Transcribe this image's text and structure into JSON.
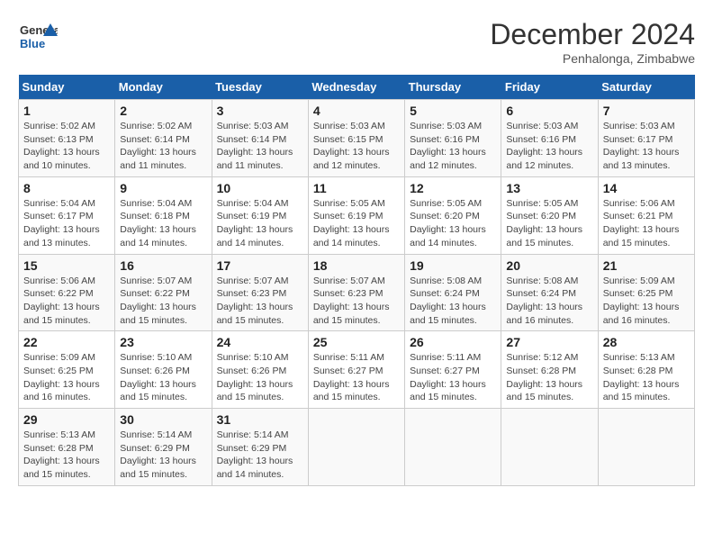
{
  "logo": {
    "general": "General",
    "blue": "Blue"
  },
  "header": {
    "month": "December 2024",
    "location": "Penhalonga, Zimbabwe"
  },
  "weekdays": [
    "Sunday",
    "Monday",
    "Tuesday",
    "Wednesday",
    "Thursday",
    "Friday",
    "Saturday"
  ],
  "weeks": [
    [
      {
        "day": "1",
        "info": "Sunrise: 5:02 AM\nSunset: 6:13 PM\nDaylight: 13 hours\nand 10 minutes."
      },
      {
        "day": "2",
        "info": "Sunrise: 5:02 AM\nSunset: 6:14 PM\nDaylight: 13 hours\nand 11 minutes."
      },
      {
        "day": "3",
        "info": "Sunrise: 5:03 AM\nSunset: 6:14 PM\nDaylight: 13 hours\nand 11 minutes."
      },
      {
        "day": "4",
        "info": "Sunrise: 5:03 AM\nSunset: 6:15 PM\nDaylight: 13 hours\nand 12 minutes."
      },
      {
        "day": "5",
        "info": "Sunrise: 5:03 AM\nSunset: 6:16 PM\nDaylight: 13 hours\nand 12 minutes."
      },
      {
        "day": "6",
        "info": "Sunrise: 5:03 AM\nSunset: 6:16 PM\nDaylight: 13 hours\nand 12 minutes."
      },
      {
        "day": "7",
        "info": "Sunrise: 5:03 AM\nSunset: 6:17 PM\nDaylight: 13 hours\nand 13 minutes."
      }
    ],
    [
      {
        "day": "8",
        "info": "Sunrise: 5:04 AM\nSunset: 6:17 PM\nDaylight: 13 hours\nand 13 minutes."
      },
      {
        "day": "9",
        "info": "Sunrise: 5:04 AM\nSunset: 6:18 PM\nDaylight: 13 hours\nand 14 minutes."
      },
      {
        "day": "10",
        "info": "Sunrise: 5:04 AM\nSunset: 6:19 PM\nDaylight: 13 hours\nand 14 minutes."
      },
      {
        "day": "11",
        "info": "Sunrise: 5:05 AM\nSunset: 6:19 PM\nDaylight: 13 hours\nand 14 minutes."
      },
      {
        "day": "12",
        "info": "Sunrise: 5:05 AM\nSunset: 6:20 PM\nDaylight: 13 hours\nand 14 minutes."
      },
      {
        "day": "13",
        "info": "Sunrise: 5:05 AM\nSunset: 6:20 PM\nDaylight: 13 hours\nand 15 minutes."
      },
      {
        "day": "14",
        "info": "Sunrise: 5:06 AM\nSunset: 6:21 PM\nDaylight: 13 hours\nand 15 minutes."
      }
    ],
    [
      {
        "day": "15",
        "info": "Sunrise: 5:06 AM\nSunset: 6:22 PM\nDaylight: 13 hours\nand 15 minutes."
      },
      {
        "day": "16",
        "info": "Sunrise: 5:07 AM\nSunset: 6:22 PM\nDaylight: 13 hours\nand 15 minutes."
      },
      {
        "day": "17",
        "info": "Sunrise: 5:07 AM\nSunset: 6:23 PM\nDaylight: 13 hours\nand 15 minutes."
      },
      {
        "day": "18",
        "info": "Sunrise: 5:07 AM\nSunset: 6:23 PM\nDaylight: 13 hours\nand 15 minutes."
      },
      {
        "day": "19",
        "info": "Sunrise: 5:08 AM\nSunset: 6:24 PM\nDaylight: 13 hours\nand 15 minutes."
      },
      {
        "day": "20",
        "info": "Sunrise: 5:08 AM\nSunset: 6:24 PM\nDaylight: 13 hours\nand 16 minutes."
      },
      {
        "day": "21",
        "info": "Sunrise: 5:09 AM\nSunset: 6:25 PM\nDaylight: 13 hours\nand 16 minutes."
      }
    ],
    [
      {
        "day": "22",
        "info": "Sunrise: 5:09 AM\nSunset: 6:25 PM\nDaylight: 13 hours\nand 16 minutes."
      },
      {
        "day": "23",
        "info": "Sunrise: 5:10 AM\nSunset: 6:26 PM\nDaylight: 13 hours\nand 15 minutes."
      },
      {
        "day": "24",
        "info": "Sunrise: 5:10 AM\nSunset: 6:26 PM\nDaylight: 13 hours\nand 15 minutes."
      },
      {
        "day": "25",
        "info": "Sunrise: 5:11 AM\nSunset: 6:27 PM\nDaylight: 13 hours\nand 15 minutes."
      },
      {
        "day": "26",
        "info": "Sunrise: 5:11 AM\nSunset: 6:27 PM\nDaylight: 13 hours\nand 15 minutes."
      },
      {
        "day": "27",
        "info": "Sunrise: 5:12 AM\nSunset: 6:28 PM\nDaylight: 13 hours\nand 15 minutes."
      },
      {
        "day": "28",
        "info": "Sunrise: 5:13 AM\nSunset: 6:28 PM\nDaylight: 13 hours\nand 15 minutes."
      }
    ],
    [
      {
        "day": "29",
        "info": "Sunrise: 5:13 AM\nSunset: 6:28 PM\nDaylight: 13 hours\nand 15 minutes."
      },
      {
        "day": "30",
        "info": "Sunrise: 5:14 AM\nSunset: 6:29 PM\nDaylight: 13 hours\nand 15 minutes."
      },
      {
        "day": "31",
        "info": "Sunrise: 5:14 AM\nSunset: 6:29 PM\nDaylight: 13 hours\nand 14 minutes."
      },
      {
        "day": "",
        "info": ""
      },
      {
        "day": "",
        "info": ""
      },
      {
        "day": "",
        "info": ""
      },
      {
        "day": "",
        "info": ""
      }
    ]
  ]
}
